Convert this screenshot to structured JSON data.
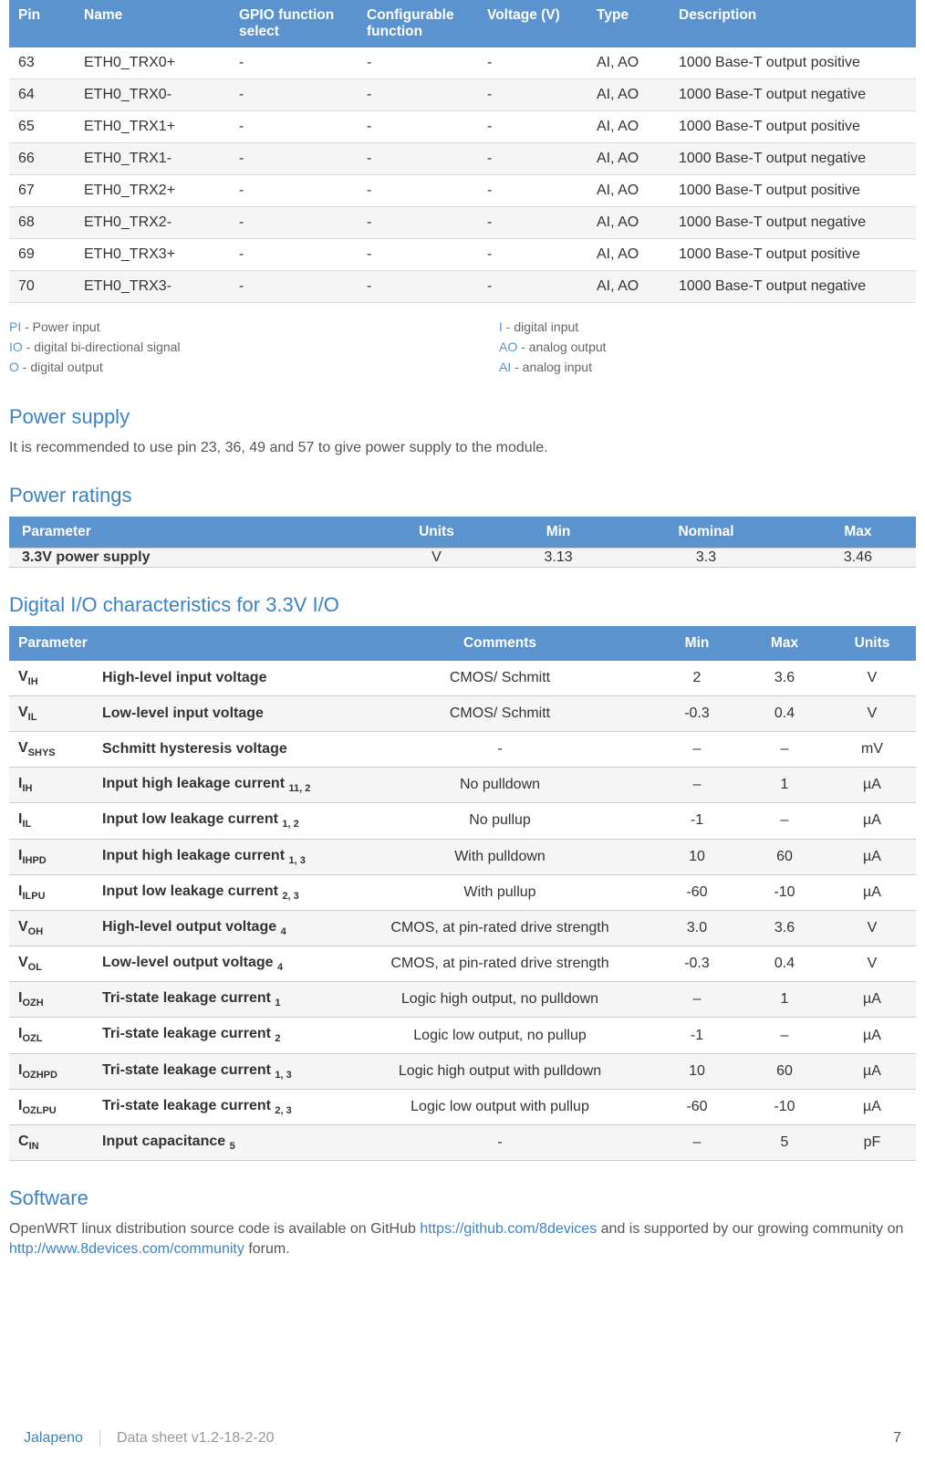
{
  "pin_table": {
    "headers": [
      "Pin",
      "Name",
      "GPIO function select",
      "Configurable function",
      "Voltage (V)",
      "Type",
      "Description"
    ],
    "rows": [
      {
        "pin": "63",
        "name": "ETH0_TRX0+",
        "gpio": "-",
        "conf": "-",
        "volt": "-",
        "type": "AI, AO",
        "desc": "1000 Base-T output positive"
      },
      {
        "pin": "64",
        "name": "ETH0_TRX0-",
        "gpio": "-",
        "conf": "-",
        "volt": "-",
        "type": "AI, AO",
        "desc": "1000 Base-T output negative"
      },
      {
        "pin": "65",
        "name": "ETH0_TRX1+",
        "gpio": "-",
        "conf": "-",
        "volt": "-",
        "type": "AI, AO",
        "desc": "1000 Base-T output positive"
      },
      {
        "pin": "66",
        "name": "ETH0_TRX1-",
        "gpio": "-",
        "conf": "-",
        "volt": "-",
        "type": "AI, AO",
        "desc": "1000 Base-T output negative"
      },
      {
        "pin": "67",
        "name": "ETH0_TRX2+",
        "gpio": "-",
        "conf": "-",
        "volt": "-",
        "type": "AI, AO",
        "desc": "1000 Base-T output positive"
      },
      {
        "pin": "68",
        "name": "ETH0_TRX2-",
        "gpio": "-",
        "conf": "-",
        "volt": "-",
        "type": "AI, AO",
        "desc": "1000 Base-T output negative"
      },
      {
        "pin": "69",
        "name": "ETH0_TRX3+",
        "gpio": "-",
        "conf": "-",
        "volt": "-",
        "type": "AI, AO",
        "desc": "1000 Base-T output positive"
      },
      {
        "pin": "70",
        "name": "ETH0_TRX3-",
        "gpio": "-",
        "conf": "-",
        "volt": "-",
        "type": "AI, AO",
        "desc": "1000 Base-T output negative"
      }
    ]
  },
  "legend": {
    "left": [
      {
        "abbr": "PI",
        "text": " - Power input"
      },
      {
        "abbr": "IO",
        "text": " - digital bi-directional signal"
      },
      {
        "abbr": "O",
        "text": " - digital output"
      }
    ],
    "right": [
      {
        "abbr": "I",
        "text": " - digital input"
      },
      {
        "abbr": "AO",
        "text": " - analog output"
      },
      {
        "abbr": "AI",
        "text": " - analog input"
      }
    ]
  },
  "power_supply": {
    "title": "Power supply",
    "body": "It is recommended to use pin 23, 36, 49 and 57 to give power supply to the module."
  },
  "power_ratings": {
    "title": "Power ratings",
    "headers": [
      "Parameter",
      "Units",
      "Min",
      "Nominal",
      "Max"
    ],
    "row": {
      "param": "3.3V power supply",
      "units": "V",
      "min": "3.13",
      "nom": "3.3",
      "max": "3.46"
    }
  },
  "io_char": {
    "title": "Digital I/O characteristics for 3.3V I/O",
    "headers": [
      "Parameter",
      "Comments",
      "Min",
      "Max",
      "Units"
    ],
    "rows": [
      {
        "sym": "V",
        "sub": "IH",
        "name": "High-level input voltage",
        "note": "",
        "comments": "CMOS/ Schmitt",
        "min": "2",
        "max": "3.6",
        "units": "V"
      },
      {
        "sym": "V",
        "sub": "IL",
        "name": "Low-level input voltage",
        "note": "",
        "comments": "CMOS/ Schmitt",
        "min": "-0.3",
        "max": "0.4",
        "units": "V"
      },
      {
        "sym": "V",
        "sub": "SHYS",
        "name": "Schmitt hysteresis voltage",
        "note": "",
        "comments": "-",
        "min": "–",
        "max": "–",
        "units": "mV"
      },
      {
        "sym": "I",
        "sub": "IH",
        "name": "Input high leakage current ",
        "note": "11, 2",
        "comments": "No pulldown",
        "min": "–",
        "max": "1",
        "units": "µA"
      },
      {
        "sym": "I",
        "sub": "IL",
        "name": "Input low leakage current ",
        "note": "1, 2",
        "comments": "No pullup",
        "min": "-1",
        "max": "–",
        "units": "µA"
      },
      {
        "sym": "I",
        "sub": "IHPD",
        "name": "Input high leakage current ",
        "note": "1, 3",
        "comments": "With pulldown",
        "min": "10",
        "max": "60",
        "units": "µA"
      },
      {
        "sym": "I",
        "sub": "ILPU",
        "name": "Input low leakage current ",
        "note": "2, 3",
        "comments": "With pullup",
        "min": "-60",
        "max": "-10",
        "units": "µA"
      },
      {
        "sym": "V",
        "sub": "OH",
        "name": "High-level output voltage ",
        "note": "4",
        "comments": "CMOS, at pin-rated drive strength",
        "min": "3.0",
        "max": "3.6",
        "units": "V"
      },
      {
        "sym": "V",
        "sub": "OL",
        "name": "Low-level output voltage ",
        "note": "4",
        "comments": "CMOS, at pin-rated drive strength",
        "min": "-0.3",
        "max": "0.4",
        "units": "V"
      },
      {
        "sym": "I",
        "sub": "OZH",
        "name": "Tri-state leakage current ",
        "note": "1",
        "comments": "Logic high output, no pulldown",
        "min": "–",
        "max": "1",
        "units": "µA"
      },
      {
        "sym": "I",
        "sub": "OZL",
        "name": "Tri-state leakage current ",
        "note": "2",
        "comments": "Logic low output, no pullup",
        "min": "-1",
        "max": "–",
        "units": "µA"
      },
      {
        "sym": "I",
        "sub": "OZHPD",
        "name": "Tri-state leakage current ",
        "note": "1, 3",
        "comments": "Logic high output with pulldown",
        "min": "10",
        "max": "60",
        "units": "µA"
      },
      {
        "sym": "I",
        "sub": "OZLPU",
        "name": "Tri-state leakage current ",
        "note": "2, 3",
        "comments": "Logic low output with pullup",
        "min": "-60",
        "max": "-10",
        "units": "µA"
      },
      {
        "sym": "C",
        "sub": "IN",
        "name": "Input capacitance ",
        "note": "5",
        "comments": "-",
        "min": "–",
        "max": "5",
        "units": "pF"
      }
    ]
  },
  "software": {
    "title": "Software",
    "pre": "OpenWRT linux distribution source code is available on GitHub ",
    "link1": "https://github.com/8devices",
    "mid": " and is supported by our growing community on ",
    "link2": "http://www.8devices.com/community",
    "post": " forum."
  },
  "footer": {
    "brand": "Jalapeno",
    "doc": "Data sheet v1.2-18-2-20",
    "page": "7"
  }
}
